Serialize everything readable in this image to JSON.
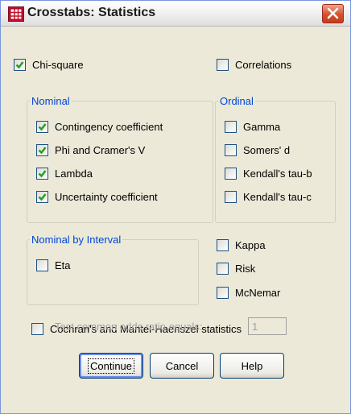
{
  "window": {
    "title": "Crosstabs: Statistics"
  },
  "chi_square": {
    "label": "Chi-square",
    "checked": true
  },
  "correlations": {
    "label": "Correlations",
    "checked": false
  },
  "nominal": {
    "title": "Nominal",
    "items": [
      {
        "label": "Contingency coefficient",
        "checked": true
      },
      {
        "label": "Phi and Cramer's V",
        "checked": true
      },
      {
        "label": "Lambda",
        "checked": true
      },
      {
        "label": "Uncertainty coefficient",
        "checked": true
      }
    ]
  },
  "ordinal": {
    "title": "Ordinal",
    "items": [
      {
        "label": "Gamma",
        "checked": false
      },
      {
        "label": "Somers' d",
        "checked": false
      },
      {
        "label": "Kendall's tau-b",
        "checked": false
      },
      {
        "label": "Kendall's tau-c",
        "checked": false
      }
    ]
  },
  "nominal_by_interval": {
    "title": "Nominal by Interval",
    "items": [
      {
        "label": "Eta",
        "checked": false
      }
    ]
  },
  "other": {
    "items": [
      {
        "label": "Kappa",
        "checked": false
      },
      {
        "label": "Risk",
        "checked": false
      },
      {
        "label": "McNemar",
        "checked": false
      }
    ]
  },
  "cochran": {
    "label": "Cochran's and Mantel-Haenszel statistics",
    "checked": false
  },
  "odds": {
    "label": "Test common odds ratio equals:",
    "value": "1"
  },
  "buttons": {
    "continue": "Continue",
    "cancel": "Cancel",
    "help": "Help"
  }
}
